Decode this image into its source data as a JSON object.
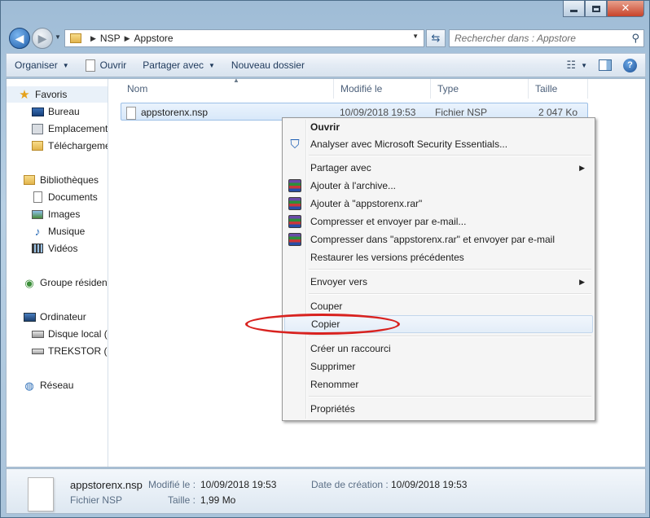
{
  "window": {
    "colors": {
      "title_gradient": "#a9c3da",
      "close": "#c7432a",
      "selection": "#d8e8f9",
      "annotation": "#d8221f"
    }
  },
  "navigation": {
    "breadcrumb": [
      "NSP",
      "Appstore"
    ],
    "search_placeholder": "Rechercher dans : Appstore"
  },
  "toolbar": {
    "organize": "Organiser",
    "open": "Ouvrir",
    "share": "Partager avec",
    "new_folder": "Nouveau dossier"
  },
  "sidebar": {
    "favorites": {
      "label": "Favoris",
      "items": [
        "Bureau",
        "Emplacement",
        "Téléchargeme"
      ]
    },
    "libraries": {
      "label": "Bibliothèques",
      "items": [
        "Documents",
        "Images",
        "Musique",
        "Vidéos"
      ]
    },
    "homegroup": "Groupe résident",
    "computer": {
      "label": "Ordinateur",
      "items": [
        "Disque local (",
        "TREKSTOR (E:"
      ]
    },
    "network": "Réseau"
  },
  "file_list": {
    "columns": [
      "Nom",
      "Modifié le",
      "Type",
      "Taille"
    ],
    "rows": [
      {
        "name": "appstorenx.nsp",
        "modified": "10/09/2018 19:53",
        "type": "Fichier NSP",
        "size": "2 047 Ko"
      }
    ]
  },
  "context_menu": {
    "open": "Ouvrir",
    "scan": "Analyser avec Microsoft Security Essentials...",
    "share": "Partager avec",
    "add_archive": "Ajouter à l'archive...",
    "add_rar": "Ajouter à \"appstorenx.rar\"",
    "compress_email": "Compresser et envoyer par e-mail...",
    "compress_rar_email": "Compresser dans \"appstorenx.rar\" et envoyer par e-mail",
    "restore": "Restaurer les versions précédentes",
    "send_to": "Envoyer vers",
    "cut": "Couper",
    "copy": "Copier",
    "shortcut": "Créer un raccourci",
    "delete": "Supprimer",
    "rename": "Renommer",
    "properties": "Propriétés"
  },
  "details": {
    "name": "appstorenx.nsp",
    "type": "Fichier NSP",
    "modified_label": "Modifié le :",
    "modified_value": "10/09/2018 19:53",
    "size_label": "Taille :",
    "size_value": "1,99 Mo",
    "created_label": "Date de création :",
    "created_value": "10/09/2018 19:53"
  }
}
